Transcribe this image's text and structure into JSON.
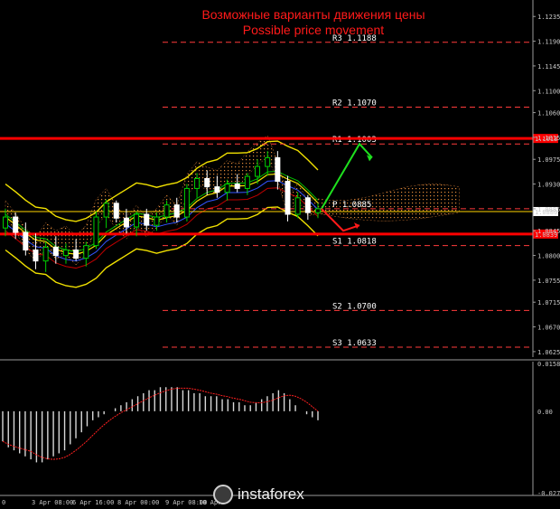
{
  "chart_data": {
    "type": "candlestick",
    "title": "Возможные варианты движения цены",
    "subtitle": "Possible price movement",
    "symbol_note": "",
    "price_axis": {
      "ylim": [
        1.0615,
        1.1265
      ],
      "ticks": [
        1.1235,
        1.119,
        1.1145,
        1.11,
        1.106,
        1.1015,
        1.0975,
        1.093,
        1.0885,
        1.0845,
        1.08,
        1.0755,
        1.0715,
        1.067,
        1.0625
      ],
      "tick_labels": [
        "1.1235",
        "1.1190",
        "1.1145",
        "1.1100",
        "1.1060",
        "1.1015",
        "1.0975",
        "1.0930",
        "1.0885",
        "1.0845",
        "1.0800",
        "1.0755",
        "1.0715",
        "1.0670",
        "1.0625"
      ]
    },
    "levels": [
      {
        "name": "R3",
        "value": 1.1188,
        "label": "R3  1.1188",
        "color": "#ff3b3b",
        "style": "dashed"
      },
      {
        "name": "R2",
        "value": 1.107,
        "label": "R2  1.1070",
        "color": "#ff3b3b",
        "style": "dashed"
      },
      {
        "name": "R1",
        "value": 1.1003,
        "label": "R1  1.1003",
        "color": "#ff3b3b",
        "style": "dashed"
      },
      {
        "name": "P",
        "value": 1.0885,
        "label": "P  1.0885",
        "color": "#ff3b3b",
        "style": "dashed"
      },
      {
        "name": "S1",
        "value": 1.0818,
        "label": "S1  1.0818",
        "color": "#ff3b3b",
        "style": "dashed"
      },
      {
        "name": "S2",
        "value": 1.07,
        "label": "S2  1.0700",
        "color": "#ff3b3b",
        "style": "dashed"
      },
      {
        "name": "S3",
        "value": 1.0633,
        "label": "S3  1.0633",
        "color": "#ff3b3b",
        "style": "dashed"
      }
    ],
    "support_resistance_lines": [
      {
        "value": 1.1013,
        "label": "1.1013",
        "color": "#ff0000"
      },
      {
        "value": 1.0839,
        "label": "1.0839",
        "color": "#ff0000"
      }
    ],
    "current_price": {
      "value": 1.088,
      "label": "1.0880",
      "color": "#ffd400"
    },
    "candles": [
      {
        "o": 1.085,
        "h": 1.0885,
        "l": 1.0835,
        "c": 1.087
      },
      {
        "o": 1.087,
        "h": 1.0878,
        "l": 1.083,
        "c": 1.0842
      },
      {
        "o": 1.0842,
        "h": 1.086,
        "l": 1.08,
        "c": 1.081
      },
      {
        "o": 1.081,
        "h": 1.084,
        "l": 1.0775,
        "c": 1.079
      },
      {
        "o": 1.079,
        "h": 1.0825,
        "l": 1.077,
        "c": 1.0815
      },
      {
        "o": 1.0815,
        "h": 1.0835,
        "l": 1.0785,
        "c": 1.08
      },
      {
        "o": 1.08,
        "h": 1.0822,
        "l": 1.0785,
        "c": 1.081
      },
      {
        "o": 1.081,
        "h": 1.083,
        "l": 1.079,
        "c": 1.0795
      },
      {
        "o": 1.0795,
        "h": 1.0825,
        "l": 1.078,
        "c": 1.0818
      },
      {
        "o": 1.0818,
        "h": 1.088,
        "l": 1.0812,
        "c": 1.087
      },
      {
        "o": 1.087,
        "h": 1.0902,
        "l": 1.085,
        "c": 1.0895
      },
      {
        "o": 1.0895,
        "h": 1.09,
        "l": 1.086,
        "c": 1.0868
      },
      {
        "o": 1.0868,
        "h": 1.0885,
        "l": 1.084,
        "c": 1.0852
      },
      {
        "o": 1.0852,
        "h": 1.088,
        "l": 1.0835,
        "c": 1.0875
      },
      {
        "o": 1.0875,
        "h": 1.0885,
        "l": 1.0845,
        "c": 1.0855
      },
      {
        "o": 1.0855,
        "h": 1.0878,
        "l": 1.0845,
        "c": 1.087
      },
      {
        "o": 1.087,
        "h": 1.09,
        "l": 1.086,
        "c": 1.0892
      },
      {
        "o": 1.0892,
        "h": 1.0905,
        "l": 1.086,
        "c": 1.087
      },
      {
        "o": 1.087,
        "h": 1.093,
        "l": 1.0862,
        "c": 1.0922
      },
      {
        "o": 1.0922,
        "h": 1.095,
        "l": 1.0905,
        "c": 1.094
      },
      {
        "o": 1.094,
        "h": 1.0955,
        "l": 1.091,
        "c": 1.0925
      },
      {
        "o": 1.0925,
        "h": 1.0945,
        "l": 1.0905,
        "c": 1.0915
      },
      {
        "o": 1.0915,
        "h": 1.0938,
        "l": 1.09,
        "c": 1.093
      },
      {
        "o": 1.093,
        "h": 1.0948,
        "l": 1.0915,
        "c": 1.0922
      },
      {
        "o": 1.0922,
        "h": 1.095,
        "l": 1.091,
        "c": 1.0944
      },
      {
        "o": 1.0944,
        "h": 1.0975,
        "l": 1.093,
        "c": 1.0962
      },
      {
        "o": 1.0962,
        "h": 1.099,
        "l": 1.0945,
        "c": 1.0978
      },
      {
        "o": 1.0978,
        "h": 1.099,
        "l": 1.092,
        "c": 1.0935
      },
      {
        "o": 1.0935,
        "h": 1.0945,
        "l": 1.0862,
        "c": 1.0875
      },
      {
        "o": 1.0875,
        "h": 1.0915,
        "l": 1.0868,
        "c": 1.0905
      },
      {
        "o": 1.0905,
        "h": 1.091,
        "l": 1.0865,
        "c": 1.0878
      },
      {
        "o": 1.0878,
        "h": 1.0895,
        "l": 1.0868,
        "c": 1.0885
      }
    ],
    "scenarios": [
      {
        "direction": "up",
        "from": 1.0885,
        "to": 1.1003,
        "color": "#1ee01e"
      },
      {
        "direction": "down",
        "from": 1.0885,
        "to": 1.0845,
        "color": "#ff1a1a"
      }
    ],
    "macd_axis": {
      "ylim": [
        -0.028,
        0.0165
      ],
      "ticks": [
        0.01585,
        0.0,
        -0.02714
      ],
      "tick_labels": [
        "0.01585",
        "0.00",
        "-0.02714"
      ]
    },
    "macd_histogram": [
      -0.01,
      -0.012,
      -0.013,
      -0.014,
      -0.015,
      -0.016,
      -0.017,
      -0.017,
      -0.016,
      -0.015,
      -0.014,
      -0.013,
      -0.011,
      -0.009,
      -0.007,
      -0.005,
      -0.003,
      -0.002,
      -0.001,
      0.0,
      0.001,
      0.002,
      0.003,
      0.004,
      0.005,
      0.006,
      0.007,
      0.007,
      0.008,
      0.008,
      0.008,
      0.008,
      0.007,
      0.007,
      0.006,
      0.006,
      0.005,
      0.005,
      0.005,
      0.004,
      0.004,
      0.003,
      0.003,
      0.002,
      0.002,
      0.003,
      0.004,
      0.005,
      0.006,
      0.007,
      0.006,
      0.004,
      0.002,
      0.0,
      -0.001,
      -0.002,
      -0.003
    ],
    "x_labels": [
      "0",
      "3 Apr 08:00",
      "6 Apr 16:00",
      "8 Apr 00:00",
      "9 Apr 08:00",
      "10 Apr"
    ]
  },
  "watermark": {
    "text": "instaforex"
  }
}
